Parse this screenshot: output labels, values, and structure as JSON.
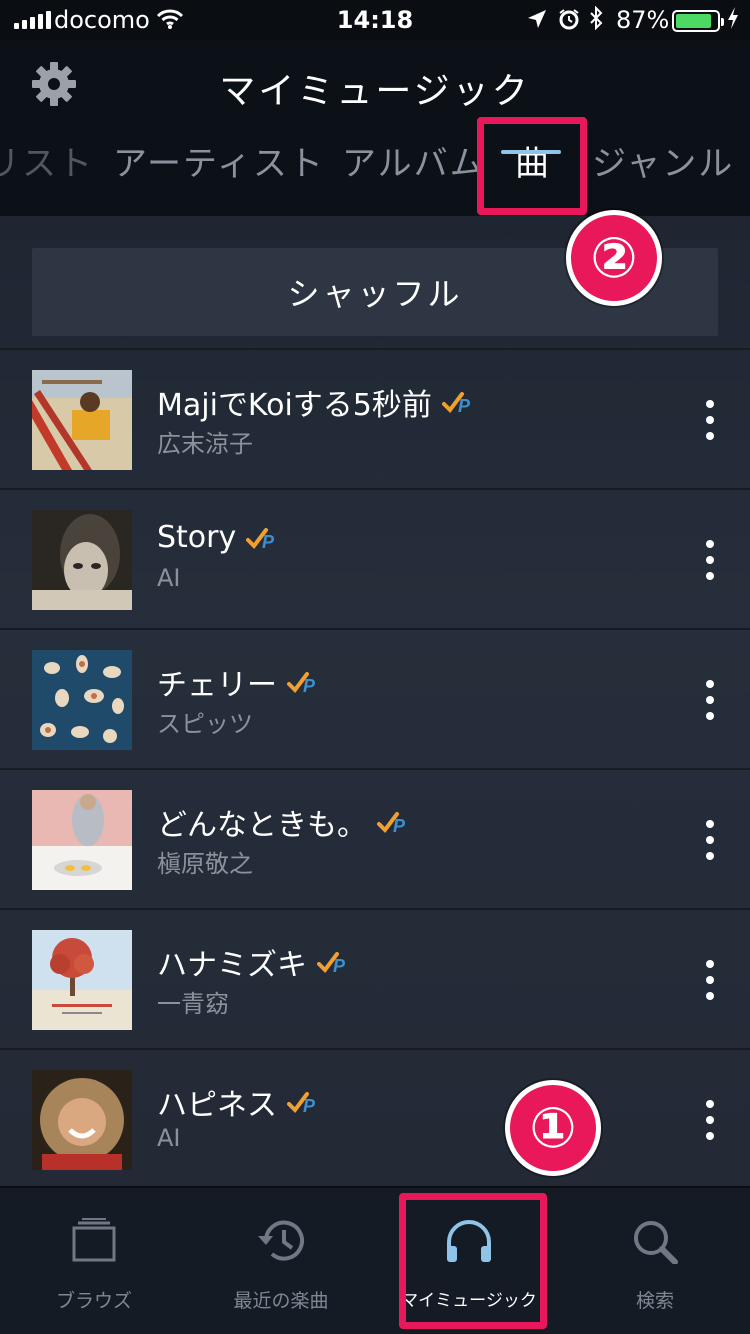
{
  "status": {
    "carrier": "docomo",
    "time": "14:18",
    "battery_pct": "87%",
    "battery_level": 0.87
  },
  "header": {
    "title": "マイミュージック",
    "tabs": [
      {
        "label": "リスト",
        "active": false
      },
      {
        "label": "アーティスト",
        "active": false
      },
      {
        "label": "アルバム",
        "active": false
      },
      {
        "label": "曲",
        "active": true
      },
      {
        "label": "ジャンル",
        "active": false
      }
    ]
  },
  "shuffle_label": "シャッフル",
  "songs": [
    {
      "title": "MajiでKoiする5秒前",
      "artist": "広末涼子",
      "prime": true
    },
    {
      "title": "Story",
      "artist": "AI",
      "prime": true
    },
    {
      "title": "チェリー",
      "artist": "スピッツ",
      "prime": true
    },
    {
      "title": "どんなときも。",
      "artist": "槇原敬之",
      "prime": true
    },
    {
      "title": "ハナミズキ",
      "artist": "一青窈",
      "prime": true
    },
    {
      "title": "ハピネス",
      "artist": "AI",
      "prime": true
    }
  ],
  "tab_bar": [
    {
      "label": "ブラウズ",
      "icon": "browse-icon",
      "active": false
    },
    {
      "label": "最近の楽曲",
      "icon": "history-icon",
      "active": false
    },
    {
      "label": "マイミュージック",
      "icon": "headphones-icon",
      "active": true
    },
    {
      "label": "検索",
      "icon": "search-icon",
      "active": false
    }
  ],
  "annotations": [
    {
      "number": "①"
    },
    {
      "number": "②"
    }
  ],
  "colors": {
    "accent_blue": "#8fc3e8",
    "annotation_pink": "#e8185a",
    "prime_check": "#f0a030",
    "prime_p": "#3d8fd0"
  }
}
